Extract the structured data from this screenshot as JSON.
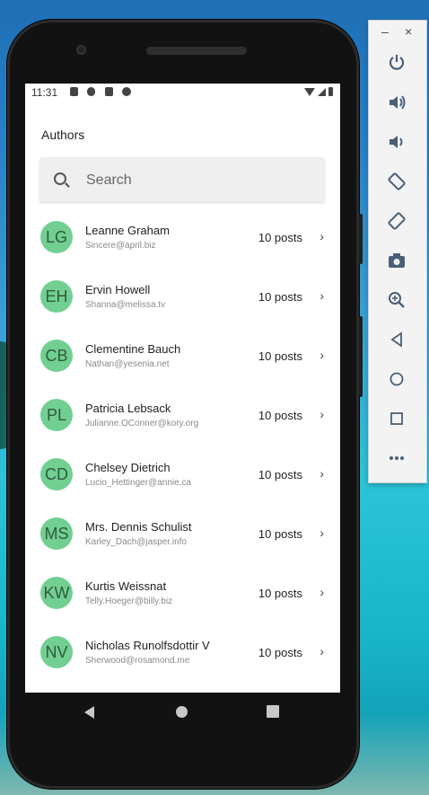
{
  "status_bar": {
    "time": "11:31"
  },
  "app": {
    "title": "Authors",
    "search": {
      "placeholder": "Search",
      "value": ""
    }
  },
  "authors": [
    {
      "initials": "LG",
      "name": "Leanne Graham",
      "email": "Sincere@april.biz",
      "posts": "10 posts"
    },
    {
      "initials": "EH",
      "name": "Ervin Howell",
      "email": "Shanna@melissa.tv",
      "posts": "10 posts"
    },
    {
      "initials": "CB",
      "name": "Clementine Bauch",
      "email": "Nathan@yesenia.net",
      "posts": "10 posts"
    },
    {
      "initials": "PL",
      "name": "Patricia Lebsack",
      "email": "Julianne.OConner@kory.org",
      "posts": "10 posts"
    },
    {
      "initials": "CD",
      "name": "Chelsey Dietrich",
      "email": "Lucio_Hettinger@annie.ca",
      "posts": "10 posts"
    },
    {
      "initials": "MS",
      "name": "Mrs. Dennis Schulist",
      "email": "Karley_Dach@jasper.info",
      "posts": "10 posts"
    },
    {
      "initials": "KW",
      "name": "Kurtis Weissnat",
      "email": "Telly.Hoeger@billy.biz",
      "posts": "10 posts"
    },
    {
      "initials": "NV",
      "name": "Nicholas Runolfsdottir V",
      "email": "Sherwood@rosamond.me",
      "posts": "10 posts"
    }
  ],
  "nav_icons": [
    "back-icon",
    "home-icon",
    "recents-icon"
  ],
  "emulator_panel": {
    "window_controls": {
      "minimize": "–",
      "close": "×"
    },
    "tools": [
      "power-icon",
      "volume-up-icon",
      "volume-down-icon",
      "rotate-left-icon",
      "rotate-right-icon",
      "camera-icon",
      "zoom-icon",
      "back-icon",
      "home-icon",
      "overview-icon",
      "more-icon"
    ]
  },
  "colors": {
    "avatar_bg": "#72cf92",
    "avatar_text": "#2e5b3e",
    "panel_icon": "#4a5f78"
  }
}
